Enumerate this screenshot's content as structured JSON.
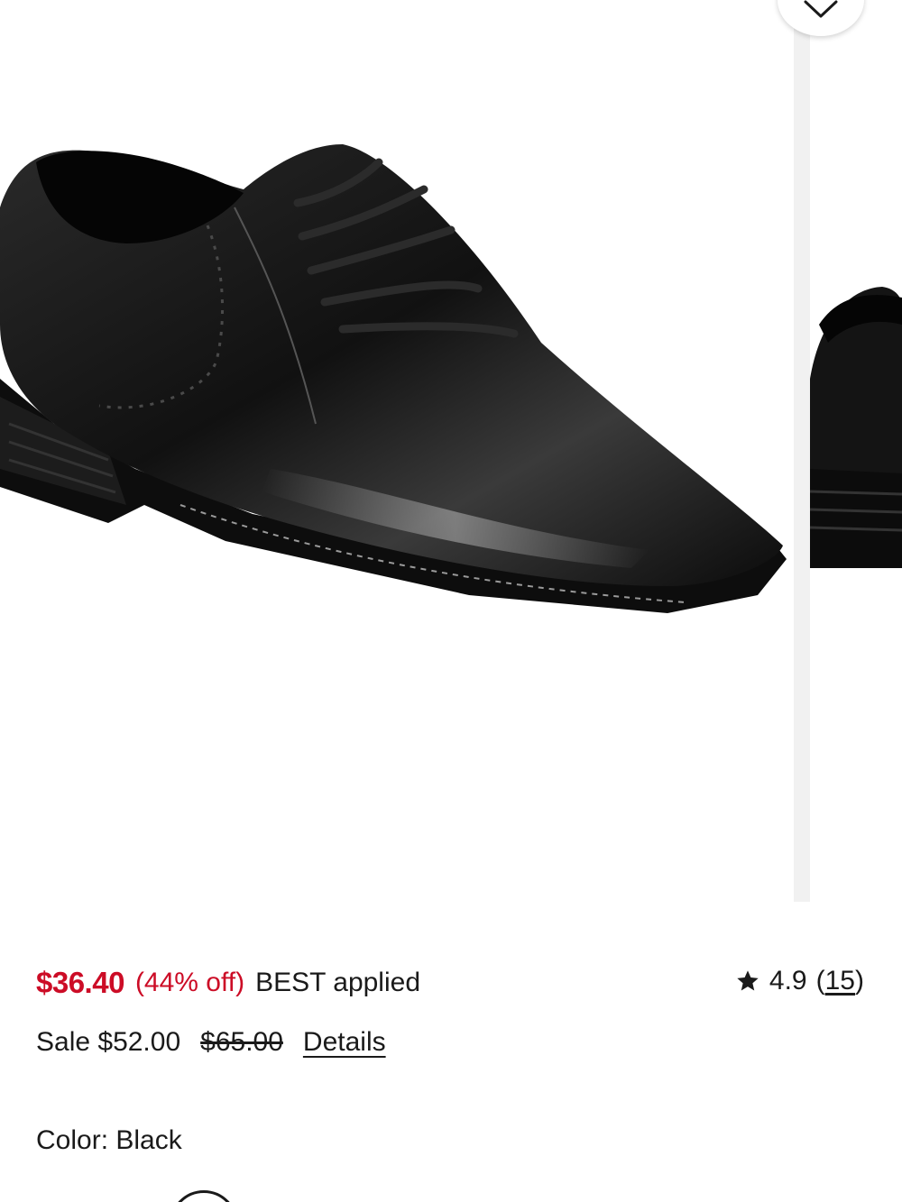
{
  "product": {
    "price": {
      "current": "$36.40",
      "percent_off": "(44% off)",
      "applied": "BEST applied",
      "sale": "Sale $52.00",
      "original": "$65.00",
      "details_link": "Details"
    },
    "rating": {
      "value": "4.9",
      "open_paren": "(",
      "count": "15",
      "close_paren": ")",
      "icon": "star-icon"
    },
    "color": {
      "label": "Color: Black"
    }
  },
  "carousel": {
    "wishlist_icon": "heart-icon"
  },
  "colors": {
    "price_red": "#cc0c26",
    "text": "#1a1a1a"
  }
}
